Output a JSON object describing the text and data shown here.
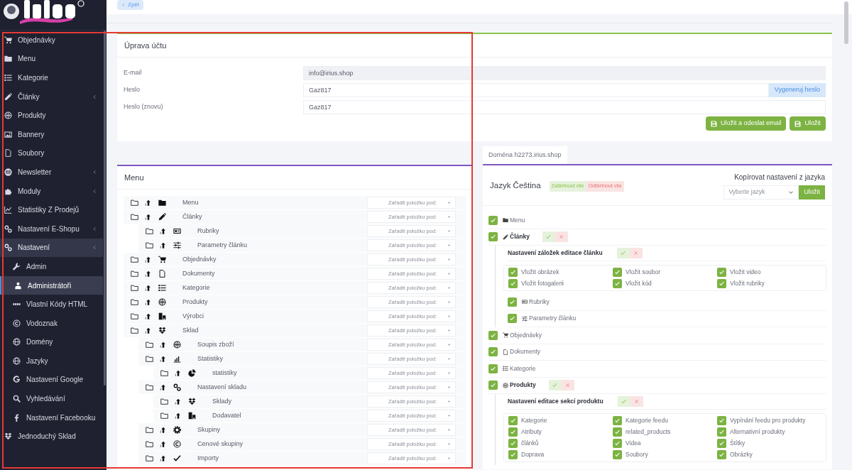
{
  "sidebar": {
    "items": [
      {
        "label": "Objednávky",
        "selected": false
      },
      {
        "label": "Menu",
        "selected": false
      },
      {
        "label": "Kategorie",
        "selected": false
      },
      {
        "label": "Články",
        "selected": false,
        "expanded": false
      },
      {
        "label": "Produkty",
        "selected": false
      },
      {
        "label": "Bannery",
        "selected": false
      },
      {
        "label": "Soubory",
        "selected": false
      },
      {
        "label": "Newsletter",
        "selected": false,
        "expanded": false
      },
      {
        "label": "Moduly",
        "selected": false,
        "expanded": false
      },
      {
        "label": "Statistiky Z Prodejů",
        "selected": false
      },
      {
        "label": "Nastavení E-Shopu",
        "selected": false,
        "expanded": false
      },
      {
        "label": "Nastavení",
        "selected": false,
        "expanded": true,
        "children": [
          {
            "label": "Admin",
            "selected": false
          },
          {
            "label": "Administrátoři",
            "selected": true
          },
          {
            "label": "Vlastní Kódy HTML",
            "selected": false
          },
          {
            "label": "Vodoznak",
            "selected": false
          },
          {
            "label": "Domény",
            "selected": false
          },
          {
            "label": "Jazyky",
            "selected": false
          },
          {
            "label": "Nastavení Google",
            "selected": false
          },
          {
            "label": "Vyhledávání",
            "selected": false
          },
          {
            "label": "Nastavení Facebooku",
            "selected": false
          }
        ]
      },
      {
        "label": "Jednoduchý Sklad",
        "selected": false
      }
    ]
  },
  "back_button": "Zpět",
  "account_card": {
    "title": "Úprava účtu",
    "fields": [
      {
        "label": "E-mail",
        "value": "info@irius.shop",
        "disabled": true
      },
      {
        "label": "Heslo",
        "value": "Gaz817",
        "disabled": false,
        "button": "Vygeneruj heslo"
      },
      {
        "label": "Heslo (znovu)",
        "value": "Gaz817",
        "disabled": false
      }
    ],
    "buttons": [
      "Uložit a odeslat email",
      "Uložit"
    ]
  },
  "menu_card": {
    "title": "Menu",
    "tree": [
      {
        "label": "Menu",
        "placeholder": "Zařadit položku pod:"
      },
      {
        "label": "Články",
        "placeholder": "Zařadit položku pod:",
        "children": [
          {
            "label": "Rubriky",
            "placeholder": "Zařadit položku pod:"
          },
          {
            "label": "Parametry článku",
            "placeholder": "Zařadit položku pod:"
          }
        ]
      },
      {
        "label": "Objednávky",
        "placeholder": "Zařadit položku pod:"
      },
      {
        "label": "Dokumenty",
        "placeholder": "Zařadit položku pod:"
      },
      {
        "label": "Kategorie",
        "placeholder": "Zařadit položku pod:"
      },
      {
        "label": "Produkty",
        "placeholder": "Zařadit položku pod:"
      },
      {
        "label": "Výrobci",
        "placeholder": "Zařadit položku pod:"
      },
      {
        "label": "Sklad",
        "placeholder": "Zařadit položku pod:",
        "children": [
          {
            "label": "Soupis zboží",
            "placeholder": "Zařadit položku pod:"
          },
          {
            "label": "Statistiky",
            "placeholder": "Zařadit položku pod:",
            "children": [
              {
                "label": "statistiky",
                "placeholder": "Zařadit položku pod:"
              }
            ]
          },
          {
            "label": "Nastavení skladu",
            "placeholder": "Zařadit položku pod:",
            "children": [
              {
                "label": "Sklady",
                "placeholder": "Zařadit položku pod:"
              },
              {
                "label": "Dodavatel",
                "placeholder": "Zařadit položku pod:"
              }
            ]
          },
          {
            "label": "Skupiny",
            "placeholder": "Zařadit položku pod:"
          },
          {
            "label": "Cenové skupiny",
            "placeholder": "Zařadit položku pod:"
          },
          {
            "label": "Importy",
            "placeholder": "Zařadit položku pod:"
          }
        ]
      }
    ]
  },
  "domain_tab": {
    "label": "Doména h2273.irius.shop",
    "selected": true
  },
  "language_card": {
    "title": "Jazyk Čeština",
    "check_all": "Zaškrtnout vše",
    "uncheck_all": "Odškrtnout vše",
    "copy_label": "Kopírovat nastavení z jazyka",
    "copy_select": {
      "placeholder": "Vyberte jazyk"
    },
    "copy_button": "Uložit",
    "permissions": [
      {
        "label": "Menu",
        "checked": true,
        "toggles": false
      },
      {
        "label": "Články",
        "checked": true,
        "toggles": true,
        "settings": {
          "title": "Nastavení záložek editace článku",
          "options": [
            {
              "label": "Vložit obrázek",
              "checked": true
            },
            {
              "label": "Vložit soubor",
              "checked": true
            },
            {
              "label": "Vložit video",
              "checked": true
            },
            {
              "label": "Vložit fotogalerii",
              "checked": true
            },
            {
              "label": "Vložit kód",
              "checked": true
            },
            {
              "label": "Vložit rubriky",
              "checked": true
            }
          ]
        },
        "children": [
          {
            "label": "Rubriky",
            "checked": true,
            "toggles": false
          },
          {
            "label": "Parametry článku",
            "checked": true,
            "toggles": false
          }
        ]
      },
      {
        "label": "Objednávky",
        "checked": true,
        "toggles": false
      },
      {
        "label": "Dokumenty",
        "checked": true,
        "toggles": false
      },
      {
        "label": "Kategorie",
        "checked": true,
        "toggles": false
      },
      {
        "label": "Produkty",
        "checked": true,
        "toggles": true,
        "settings": {
          "title": "Nastavení editace sekcí produktu",
          "options": [
            {
              "label": "Kategorie",
              "checked": true
            },
            {
              "label": "Kategorie feedu",
              "checked": true
            },
            {
              "label": "Vypínání feedu pro produkty",
              "checked": true
            },
            {
              "label": "Atributy",
              "checked": true
            },
            {
              "label": "related_products",
              "checked": true
            },
            {
              "label": "Alternativní produkty",
              "checked": true
            },
            {
              "label": "článků",
              "checked": true
            },
            {
              "label": "Videa",
              "checked": true
            },
            {
              "label": "Štítky",
              "checked": true
            },
            {
              "label": "Doprava",
              "checked": true
            },
            {
              "label": "Soubory",
              "checked": true
            },
            {
              "label": "Obrázky",
              "checked": true
            }
          ]
        }
      }
    ]
  }
}
